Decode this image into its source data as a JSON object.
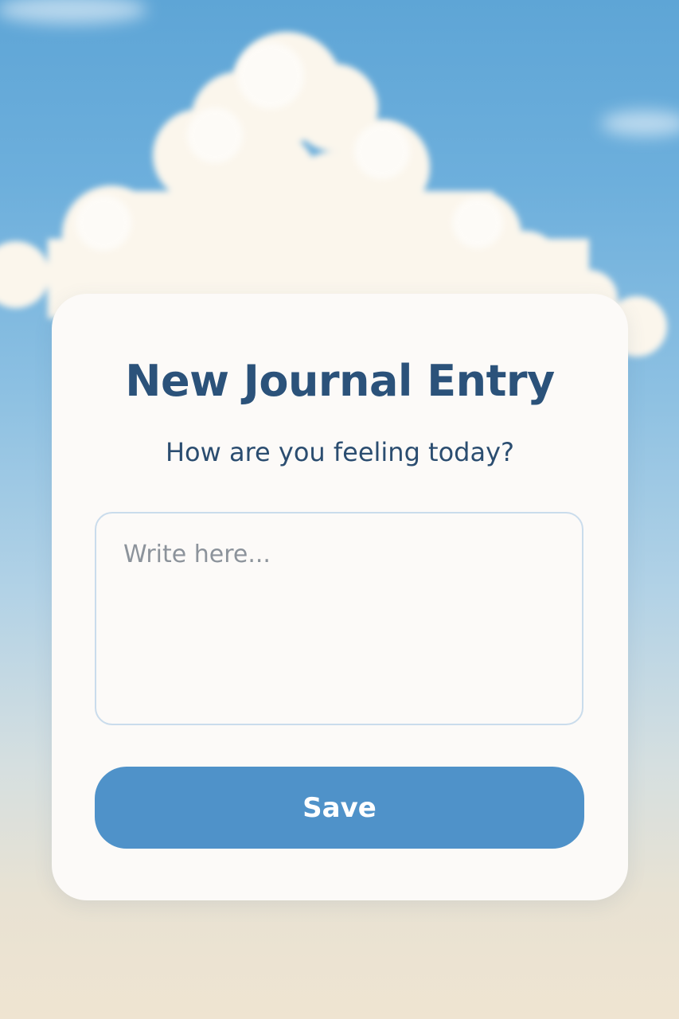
{
  "background": {
    "scene": "sky-with-clouds"
  },
  "journal_form": {
    "title": "New Journal Entry",
    "prompt": "How are you feeling today?",
    "entry_placeholder": "Write here...",
    "entry_value": "",
    "save_label": "Save"
  },
  "colors": {
    "title": "#2b527a",
    "button": "#4f92c9",
    "card": "#fcfaf8"
  }
}
